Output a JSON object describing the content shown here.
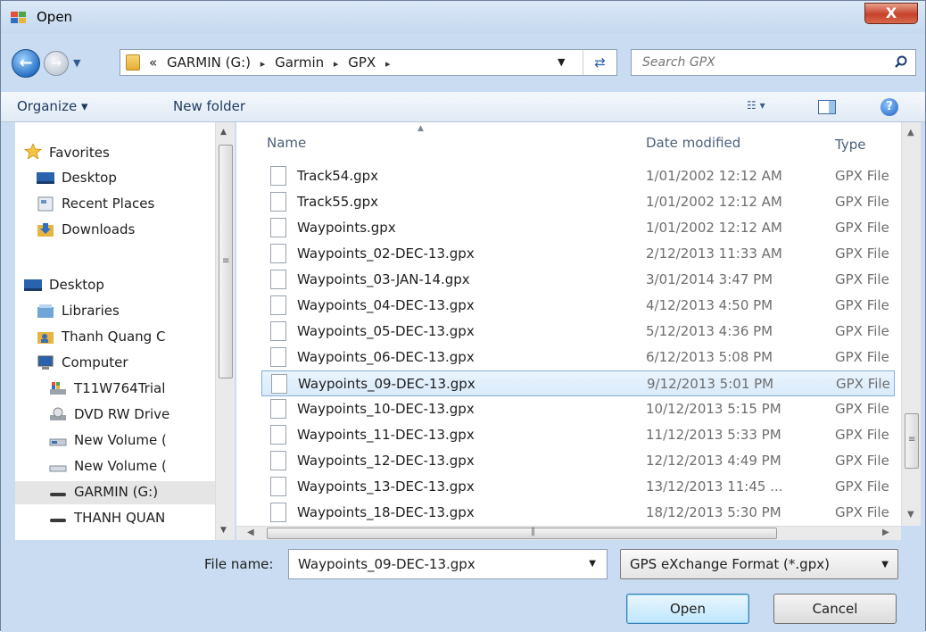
{
  "window": {
    "title": "Open",
    "close_label": "X"
  },
  "address": {
    "crumbs": [
      "«",
      "GARMIN (G:)",
      "▸",
      "Garmin",
      "▸",
      "GPX",
      "▸"
    ],
    "search_placeholder": "Search GPX"
  },
  "toolbar": {
    "organize": "Organize ▾",
    "new_folder": "New folder",
    "views": "☷ ▾",
    "help": "?"
  },
  "nav": {
    "items": [
      {
        "label": "Favorites",
        "icon": "star-icon"
      },
      {
        "label": "Desktop",
        "icon": "desktop-icon"
      },
      {
        "label": "Recent Places",
        "icon": "recent-places-icon"
      },
      {
        "label": "Downloads",
        "icon": "downloads-icon"
      },
      {
        "label": "Desktop",
        "icon": "desktop-icon"
      },
      {
        "label": "Libraries",
        "icon": "libraries-icon"
      },
      {
        "label": "Thanh Quang C",
        "icon": "user-folder-icon"
      },
      {
        "label": "Computer",
        "icon": "computer-icon"
      },
      {
        "label": "T11W764Trial",
        "icon": "system-drive-icon"
      },
      {
        "label": "DVD RW Drive",
        "icon": "dvd-drive-icon"
      },
      {
        "label": "New Volume (",
        "icon": "drive-icon"
      },
      {
        "label": "New Volume (",
        "icon": "drive-icon"
      },
      {
        "label": "GARMIN (G:)",
        "icon": "removable-drive-icon"
      },
      {
        "label": "THANH QUAN",
        "icon": "removable-drive-icon"
      }
    ]
  },
  "files": {
    "columns": {
      "name": "Name",
      "date": "Date modified",
      "type": "Type"
    },
    "rows": [
      {
        "name": "Track54.gpx",
        "date": "1/01/2002 12:12 AM",
        "type": "GPX File"
      },
      {
        "name": "Track55.gpx",
        "date": "1/01/2002 12:12 AM",
        "type": "GPX File"
      },
      {
        "name": "Waypoints.gpx",
        "date": "1/01/2002 12:12 AM",
        "type": "GPX File"
      },
      {
        "name": "Waypoints_02-DEC-13.gpx",
        "date": "2/12/2013 11:33 AM",
        "type": "GPX File"
      },
      {
        "name": "Waypoints_03-JAN-14.gpx",
        "date": "3/01/2014 3:47 PM",
        "type": "GPX File"
      },
      {
        "name": "Waypoints_04-DEC-13.gpx",
        "date": "4/12/2013 4:50 PM",
        "type": "GPX File"
      },
      {
        "name": "Waypoints_05-DEC-13.gpx",
        "date": "5/12/2013 4:36 PM",
        "type": "GPX File"
      },
      {
        "name": "Waypoints_06-DEC-13.gpx",
        "date": "6/12/2013 5:08 PM",
        "type": "GPX File"
      },
      {
        "name": "Waypoints_09-DEC-13.gpx",
        "date": "9/12/2013 5:01 PM",
        "type": "GPX File",
        "selected": true
      },
      {
        "name": "Waypoints_10-DEC-13.gpx",
        "date": "10/12/2013 5:15 PM",
        "type": "GPX File"
      },
      {
        "name": "Waypoints_11-DEC-13.gpx",
        "date": "11/12/2013 5:33 PM",
        "type": "GPX File"
      },
      {
        "name": "Waypoints_12-DEC-13.gpx",
        "date": "12/12/2013 4:49 PM",
        "type": "GPX File"
      },
      {
        "name": "Waypoints_13-DEC-13.gpx",
        "date": "13/12/2013 11:45 ...",
        "type": "GPX File"
      },
      {
        "name": "Waypoints_18-DEC-13.gpx",
        "date": "18/12/2013 5:30 PM",
        "type": "GPX File"
      }
    ]
  },
  "bottom": {
    "file_name_label": "File name:",
    "file_name_value": "Waypoints_09-DEC-13.gpx",
    "filter_value": "GPS eXchange Format (*.gpx)",
    "open_label": "Open",
    "cancel_label": "Cancel"
  }
}
